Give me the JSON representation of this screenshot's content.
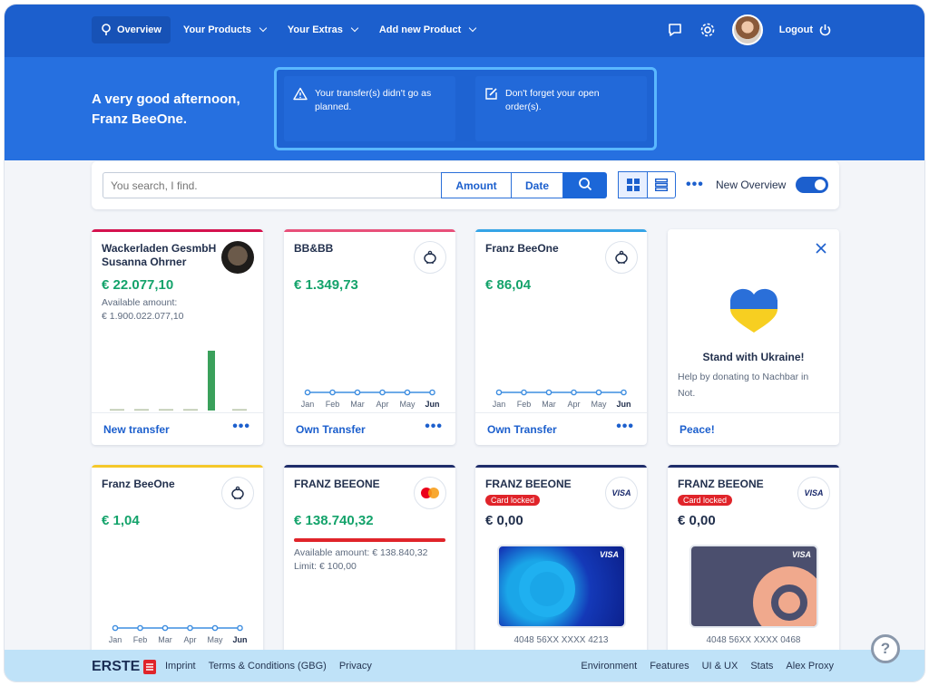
{
  "nav": {
    "overview": "Overview",
    "products": "Your Products",
    "extras": "Your Extras",
    "add": "Add new Product",
    "logout": "Logout"
  },
  "hero": {
    "greeting_line1": "A very good afternoon,",
    "greeting_line2": "Franz BeeOne.",
    "notice1": "Your transfer(s) didn't go as planned.",
    "notice2": "Don't forget your open order(s)."
  },
  "search": {
    "placeholder": "You search, I find.",
    "amount_label": "Amount",
    "date_label": "Date",
    "more": "•••",
    "new_overview_label": "New Overview",
    "new_overview_on": true
  },
  "months": [
    "Jan",
    "Feb",
    "Mar",
    "Apr",
    "May",
    "Jun"
  ],
  "cards": {
    "c1": {
      "title_line1": "Wackerladen GesmbH",
      "title_line2": "Susanna Ohrner",
      "amount": "€ 22.077,10",
      "sub1": "Available amount:",
      "sub2": "€ 1.900.022.077,10",
      "action": "New transfer",
      "dots": "•••",
      "stripe": "#d5124e",
      "bar_values": [
        0.01,
        0.01,
        0.01,
        0.01,
        1.0,
        0.01
      ]
    },
    "c2": {
      "title": "BB&BB",
      "amount": "€ 1.349,73",
      "action": "Own Transfer",
      "dots": "•••",
      "stripe": "#e8507a"
    },
    "c3": {
      "title": "Franz BeeOne",
      "amount": "€ 86,04",
      "action": "Own Transfer",
      "dots": "•••",
      "stripe": "#35a4e6"
    },
    "c4": {
      "title": "Stand with Ukraine!",
      "desc_line1": "Help by donating to Nachbar in",
      "desc_line2": "Not.",
      "action": "Peace!"
    },
    "c5": {
      "title": "Franz BeeOne",
      "amount": "€ 1,04",
      "stripe": "#f5c82a"
    },
    "c6": {
      "title": "FRANZ BEEONE",
      "amount": "€ 138.740,32",
      "sub1": "Available amount: € 138.840,32",
      "sub2": "Limit: € 100,00",
      "stripe": "#1e2c6a"
    },
    "c7": {
      "title": "FRANZ BEEONE",
      "badge": "Card locked",
      "amount": "€ 0,00",
      "visa": "VISA",
      "number": "4048 56XX XXXX 4213",
      "stripe": "#1e2c6a"
    },
    "c8": {
      "title": "FRANZ BEEONE",
      "badge": "Card locked",
      "amount": "€ 0,00",
      "visa": "VISA",
      "number": "4048 56XX XXXX 0468",
      "stripe": "#1e2c6a"
    }
  },
  "footer": {
    "brand": "ERSTE",
    "links_left": [
      "Imprint",
      "Terms & Conditions (GBG)",
      "Privacy"
    ],
    "links_right": [
      "Environment",
      "Features",
      "UI & UX",
      "Stats",
      "Alex Proxy"
    ]
  },
  "help": "?",
  "colors": {
    "primary": "#1c5fcd",
    "hero": "#2670e0",
    "positive": "#14a36b",
    "locked": "#e0242a"
  }
}
